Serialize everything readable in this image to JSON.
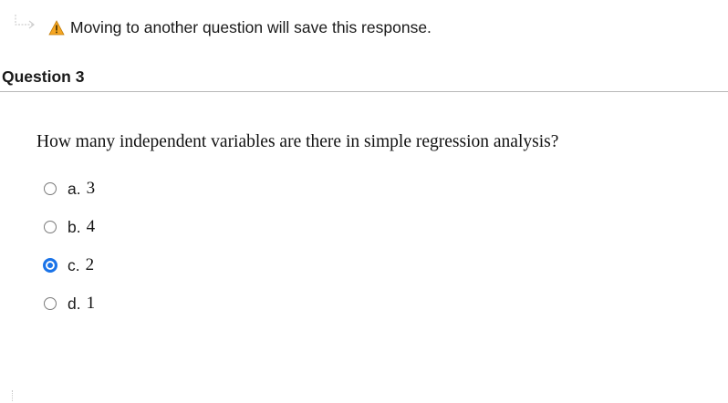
{
  "notice": {
    "icon": "warning-icon",
    "text": "Moving to another question will save this response."
  },
  "question": {
    "heading": "Question 3",
    "text": "How many independent variables are there in simple regression analysis?",
    "selected_index": 2,
    "options": [
      {
        "letter": "a.",
        "value": "3"
      },
      {
        "letter": "b.",
        "value": "4"
      },
      {
        "letter": "c.",
        "value": "2"
      },
      {
        "letter": "d.",
        "value": "1"
      }
    ]
  },
  "colors": {
    "accent": "#1a73e8",
    "warning": "#f5a623",
    "divider": "#b8b8b8"
  }
}
